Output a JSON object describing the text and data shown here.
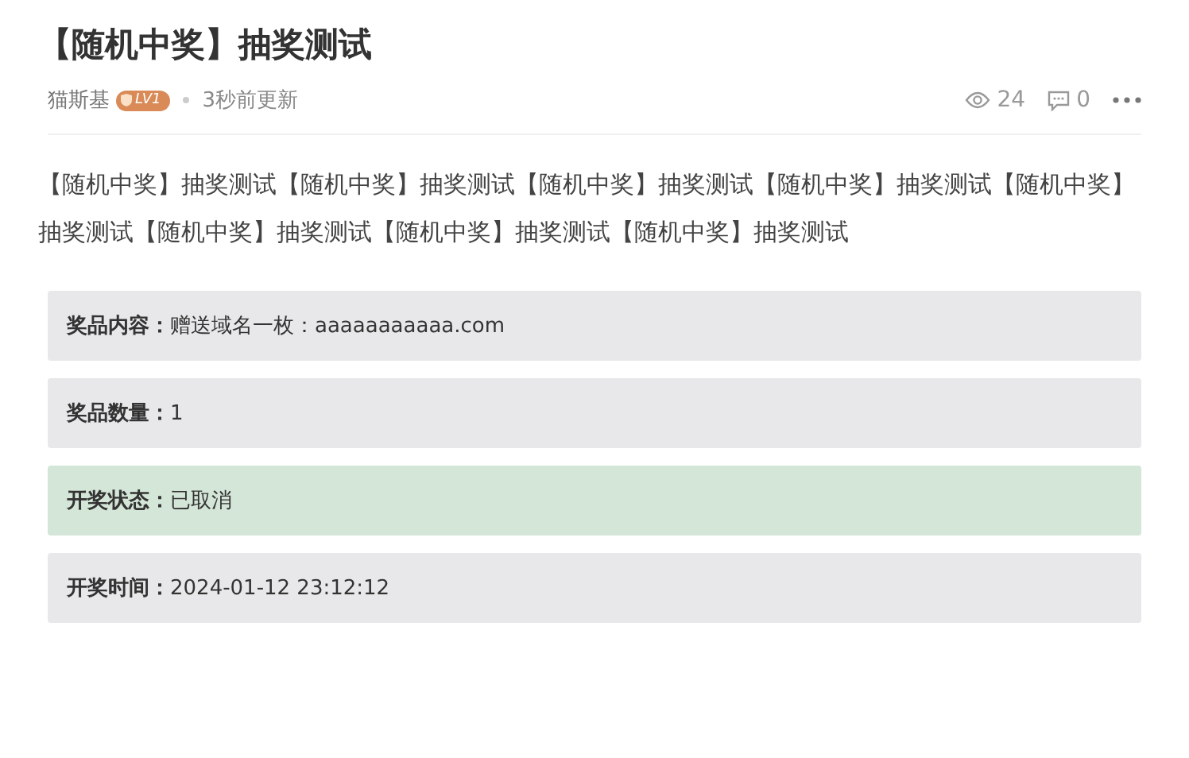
{
  "title": "【随机中奖】抽奖测试",
  "meta": {
    "author": "猫斯基",
    "level_badge": "LV1",
    "updated": "3秒前更新",
    "views": "24",
    "comments": "0"
  },
  "body": "【随机中奖】抽奖测试【随机中奖】抽奖测试【随机中奖】抽奖测试【随机中奖】抽奖测试【随机中奖】抽奖测试【随机中奖】抽奖测试【随机中奖】抽奖测试【随机中奖】抽奖测试",
  "info_rows": [
    {
      "label": "奖品内容：",
      "value": "赠送域名一枚：aaaaaaaaaaa.com",
      "highlighted": false
    },
    {
      "label": "奖品数量：",
      "value": "1",
      "highlighted": false
    },
    {
      "label": "开奖状态：",
      "value": "已取消",
      "highlighted": true
    },
    {
      "label": "开奖时间：",
      "value": "2024-01-12 23:12:12",
      "highlighted": false
    }
  ]
}
